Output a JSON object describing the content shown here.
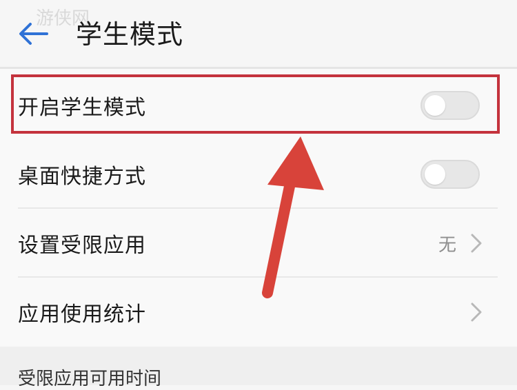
{
  "header": {
    "title": "学生模式",
    "back_icon": "back-arrow-icon",
    "watermark": "游侠网"
  },
  "list": {
    "items": [
      {
        "label": "开启学生模式",
        "control": "toggle",
        "on": false
      },
      {
        "label": "桌面快捷方式",
        "control": "toggle",
        "on": false
      },
      {
        "label": "设置受限应用",
        "control": "chevron",
        "value": "无"
      },
      {
        "label": "应用使用统计",
        "control": "chevron"
      }
    ]
  },
  "section": {
    "label": "受限应用可用时间"
  },
  "colors": {
    "highlight": "#c4333d",
    "annotation_arrow": "#d8433a",
    "back_icon": "#2f72d6"
  }
}
